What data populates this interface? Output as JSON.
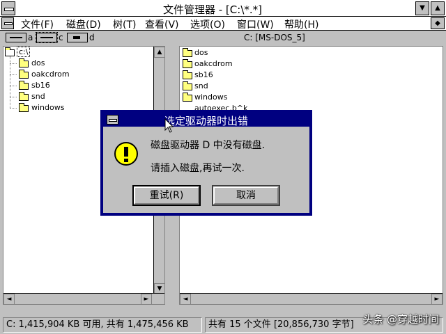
{
  "window": {
    "title": "文件管理器 - [C:\\*.*]",
    "min_glyph": "▼",
    "max_glyph": "▲"
  },
  "menu": {
    "items": [
      {
        "label": "文件(F)"
      },
      {
        "label": "磁盘(D)"
      },
      {
        "label": "树(T)"
      },
      {
        "label": "查看(V)"
      },
      {
        "label": "选项(O)"
      },
      {
        "label": "窗口(W)"
      },
      {
        "label": "帮助(H)"
      }
    ],
    "restore_glyph": "◆"
  },
  "drives": {
    "items": [
      {
        "letter": "a",
        "type": "floppy"
      },
      {
        "letter": "c",
        "type": "hard-disk",
        "selected": true
      },
      {
        "letter": "d",
        "type": "cdrom"
      }
    ],
    "current_label": "C: [MS-DOS_5]"
  },
  "tree": {
    "root": "c:\\",
    "folders": [
      {
        "name": "dos"
      },
      {
        "name": "oakcdrom"
      },
      {
        "name": "sb16"
      },
      {
        "name": "snd"
      },
      {
        "name": "windows"
      }
    ]
  },
  "files": {
    "folders": [
      {
        "name": "dos"
      },
      {
        "name": "oakcdrom"
      },
      {
        "name": "sb16"
      },
      {
        "name": "snd"
      },
      {
        "name": "windows"
      }
    ],
    "partial_file": "autoexec.b^k"
  },
  "dialog": {
    "title": "选定驱动器时出错",
    "message1": "磁盘驱动器 D 中没有磁盘.",
    "message2": "请插入磁盘,再试一次.",
    "retry_label": "重试(R)",
    "cancel_label": "取消"
  },
  "status": {
    "left": "C: 1,415,904 KB 可用, 共有 1,475,456 KB",
    "right": "共有 15 个文件 [20,856,730 字节]"
  },
  "watermark": "头条 @穿越时间",
  "icons": {
    "warning": "exclamation-icon",
    "scroll_up": "▲",
    "scroll_down": "▼",
    "scroll_left": "◄",
    "scroll_right": "►"
  },
  "colors": {
    "dialog_title_bg": "#000080",
    "face": "#c0c0c0",
    "folder": "#ffff80",
    "warning": "#ffff00"
  }
}
